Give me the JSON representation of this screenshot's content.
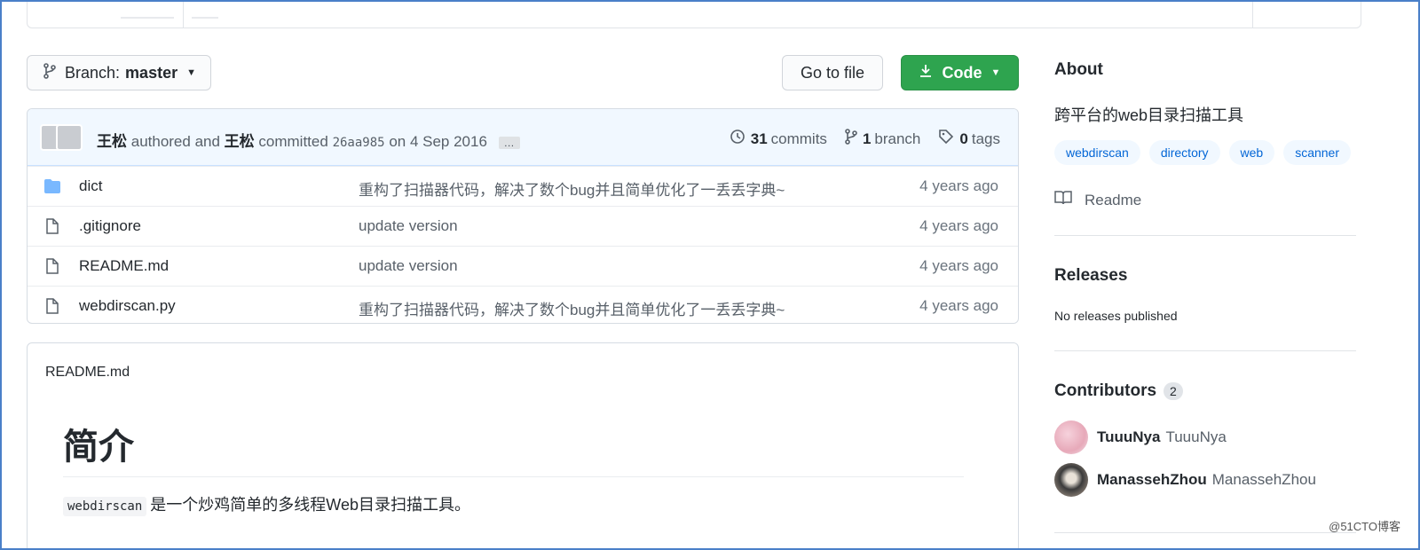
{
  "branch": {
    "label": "Branch:",
    "value": "master"
  },
  "buttons": {
    "go_to_file": "Go to file",
    "code": "Code"
  },
  "commit": {
    "author": "王松",
    "authored_text": "authored and",
    "committer": "王松",
    "committed_text": "committed",
    "sha": "26aa985",
    "date": "on 4 Sep 2016",
    "ellipsis": "…",
    "commits_count": "31",
    "commits_label": "commits",
    "branch_count": "1",
    "branch_label": "branch",
    "tags_count": "0",
    "tags_label": "tags"
  },
  "files": [
    {
      "name": "dict",
      "type": "folder",
      "message": "重构了扫描器代码，解决了数个bug并且简单优化了一丢丢字典~",
      "age": "4 years ago"
    },
    {
      "name": ".gitignore",
      "type": "file",
      "message": "update version",
      "age": "4 years ago"
    },
    {
      "name": "README.md",
      "type": "file",
      "message": "update version",
      "age": "4 years ago"
    },
    {
      "name": "webdirscan.py",
      "type": "file",
      "message": "重构了扫描器代码，解决了数个bug并且简单优化了一丢丢字典~",
      "age": "4 years ago"
    }
  ],
  "readme": {
    "file_label": "README.md",
    "heading": "简介",
    "code": "webdirscan",
    "paragraph": "是一个炒鸡简单的多线程Web目录扫描工具。"
  },
  "about": {
    "title": "About",
    "description": "跨平台的web目录扫描工具",
    "topics": [
      "webdirscan",
      "directory",
      "web",
      "scanner"
    ],
    "readme_link": "Readme"
  },
  "releases": {
    "title": "Releases",
    "empty": "No releases published"
  },
  "contributors": {
    "title": "Contributors",
    "count": "2",
    "list": [
      {
        "login": "TuuuNya",
        "name": "TuuuNya"
      },
      {
        "login": "ManassehZhou",
        "name": "ManassehZhou"
      }
    ]
  },
  "watermark": "@51CTO博客",
  "colors": {
    "primary_button": "#2ea44f",
    "link": "#0366d6",
    "folder_icon": "#79b8ff",
    "frame": "#4a7fc8"
  }
}
